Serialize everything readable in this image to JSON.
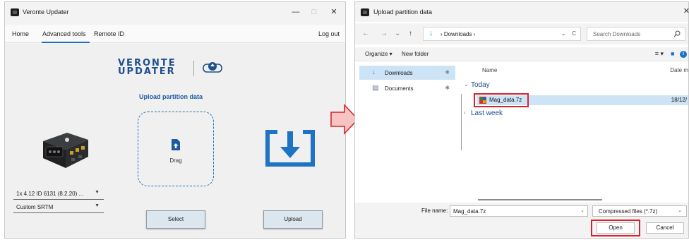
{
  "left_window": {
    "title": "Veronte Updater",
    "controls": {
      "minimize": "—",
      "maximize": "□",
      "close": "✕"
    },
    "menu": {
      "home": "Home",
      "advanced_tools": "Advanced tools",
      "remote_id": "Remote ID",
      "log_out": "Log out"
    },
    "logo": {
      "line1": "VERONTE",
      "line2": "UPDATER"
    },
    "upload_heading": "Upload partition data",
    "dropzone_label": "Drag",
    "device_select": {
      "value": "1x 4.12 ID 6131 (8.2.20) ...",
      "caret": "▼"
    },
    "srtm_select": {
      "value": "Custom SRTM",
      "caret": "▼"
    },
    "buttons": {
      "select": "Select",
      "upload": "Upload"
    }
  },
  "right_window": {
    "title": "Upload partition data",
    "close": "✕",
    "nav": {
      "back": "←",
      "forward": "→",
      "recent": "⌄",
      "up": "↑"
    },
    "path": {
      "icon": "↓",
      "text": "› Downloads ›",
      "dropdown": "⌄",
      "refresh": "C"
    },
    "search": {
      "placeholder": "Search Downloads"
    },
    "toolbar": {
      "organize": "Organize ▾",
      "new_folder": "New folder",
      "view": "≡ ▾",
      "pane": "■",
      "info": "i"
    },
    "nav_pane": [
      {
        "icon": "↓",
        "label": "Downloads",
        "pin": "✱"
      },
      {
        "icon": "▤",
        "label": "Documents",
        "pin": "✱"
      }
    ],
    "columns": {
      "name": "Name",
      "date": "Date m"
    },
    "groups": {
      "today": "Today",
      "last_week": "Last week",
      "open_chev": "⌄",
      "closed_chev": "›"
    },
    "file": {
      "name": "Mag_data.7z",
      "date": "18/12/"
    },
    "file_name_label": "File name:",
    "file_name_value": "Mag_data.7z",
    "file_type": "Compressed files (*.7z)",
    "buttons": {
      "open": "Open",
      "cancel": "Cancel"
    },
    "dropdown_caret": "⌄"
  },
  "colors": {
    "accent_blue": "#1a73c9",
    "logo_blue": "#1e4f8c",
    "highlight_red": "#d8232a",
    "selection_blue": "#cde4f7",
    "arrow_fill": "#f6c5c3",
    "arrow_stroke": "#d8232a"
  },
  "icons": {
    "app": "app-icon",
    "drop": "file-upload-icon",
    "download": "download-icon",
    "search": "search-icon",
    "archive": "archive-file-icon"
  }
}
